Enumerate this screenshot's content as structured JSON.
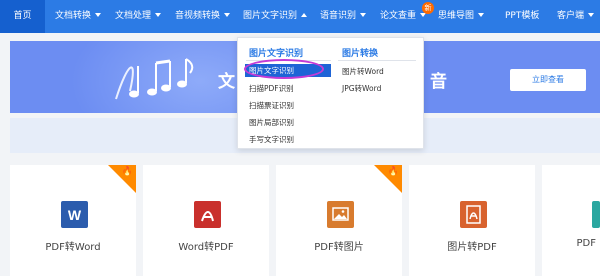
{
  "nav": {
    "home": "首页",
    "items": [
      "文档转换",
      "文档处理",
      "音视频转换",
      "图片文字识别",
      "语音识别",
      "论文查重",
      "思维导图",
      "PPT模板",
      "客户端"
    ],
    "new_badge": "新"
  },
  "banner": {
    "title": "文",
    "title_right": "音",
    "button": "立即查看"
  },
  "dropdown": {
    "col1_title": "图片文字识别",
    "col1_items": [
      "图片文字识别",
      "扫描PDF识别",
      "扫描票证识别",
      "图片局部识别",
      "手写文字识别"
    ],
    "col2_title": "图片转换",
    "col2_items": [
      "图片转Word",
      "JPG转Word"
    ]
  },
  "cards": [
    {
      "label": "PDF转Word",
      "icon_text": "W",
      "color": "#2b5cad"
    },
    {
      "label": "Word转PDF",
      "icon_text": "PDF",
      "color": "#c9302c"
    },
    {
      "label": "PDF转图片",
      "icon_text": "img",
      "color": "#d87b2e"
    },
    {
      "label": "图片转PDF",
      "icon_text": "PDF",
      "color": "#d8622e"
    },
    {
      "label": "PDF",
      "icon_text": "",
      "color": "#2aa7a0"
    }
  ],
  "colors": {
    "accent": "#2c7be5",
    "hot": "#ff8a00"
  }
}
